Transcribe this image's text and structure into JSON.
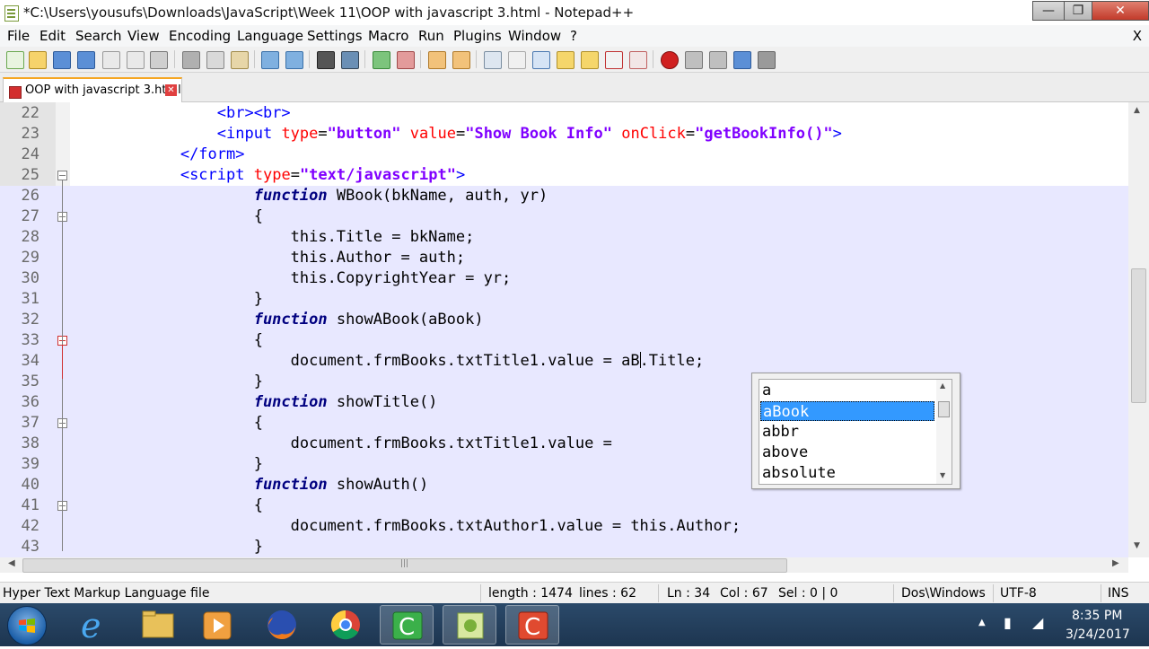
{
  "window": {
    "title": "*C:\\Users\\yousufs\\Downloads\\JavaScript\\Week 11\\OOP with javascript 3.html - Notepad++",
    "minimize": "—",
    "maximize": "❐",
    "close": "✕"
  },
  "menu": {
    "items": [
      "File",
      "Edit",
      "Search",
      "View",
      "Encoding",
      "Language",
      "Settings",
      "Macro",
      "Run",
      "Plugins",
      "Window",
      "?"
    ],
    "close_doc": "X"
  },
  "tabs": [
    {
      "label": "OOP with javascript 3.html",
      "close": "✕"
    }
  ],
  "editor": {
    "lines": [
      {
        "n": "22",
        "indent": "                ",
        "html": "<span class=\"tag\">&lt;br&gt;&lt;br&gt;</span>"
      },
      {
        "n": "23",
        "indent": "                ",
        "html": "<span class=\"tag\">&lt;input</span> <span class=\"attr\">type</span>=<span class=\"str\">\"button\"</span> <span class=\"attr\">value</span>=<span class=\"str\">\"Show Book Info\"</span> <span class=\"attr\">onClick</span>=<span class=\"str\">\"getBookInfo()\"</span><span class=\"tag\">&gt;</span>"
      },
      {
        "n": "24",
        "indent": "            ",
        "html": "<span class=\"tag\">&lt;/form&gt;</span>"
      },
      {
        "n": "25",
        "indent": "            ",
        "html": "<span class=\"tag\">&lt;script</span> <span class=\"attr\">type</span>=<span class=\"str\">\"text/javascript\"</span><span class=\"tag\">&gt;</span>"
      },
      {
        "n": "26",
        "indent": "                    ",
        "html": "<span class=\"kw\">function</span> WBook(bkName, auth, yr)"
      },
      {
        "n": "27",
        "indent": "                    ",
        "html": "{"
      },
      {
        "n": "28",
        "indent": "                        ",
        "html": "this.Title = bkName;"
      },
      {
        "n": "29",
        "indent": "                        ",
        "html": "this.Author = auth;"
      },
      {
        "n": "30",
        "indent": "                        ",
        "html": "this.CopyrightYear = yr;"
      },
      {
        "n": "31",
        "indent": "                    ",
        "html": "}"
      },
      {
        "n": "32",
        "indent": "                    ",
        "html": "<span class=\"kw\">function</span> showABook(aBook)"
      },
      {
        "n": "33",
        "indent": "                    ",
        "html": "{"
      },
      {
        "n": "34",
        "indent": "                        ",
        "html": "document.frmBooks.txtTitle1.value = aB<span class=\"caret\"></span>.Title;"
      },
      {
        "n": "35",
        "indent": "                    ",
        "html": "}"
      },
      {
        "n": "36",
        "indent": "                    ",
        "html": "<span class=\"kw\">function</span> showTitle()"
      },
      {
        "n": "37",
        "indent": "                    ",
        "html": "{"
      },
      {
        "n": "38",
        "indent": "                        ",
        "html": "document.frmBooks.txtTitle1.value = "
      },
      {
        "n": "39",
        "indent": "                    ",
        "html": "}"
      },
      {
        "n": "40",
        "indent": "                    ",
        "html": "<span class=\"kw\">function</span> showAuth()"
      },
      {
        "n": "41",
        "indent": "                    ",
        "html": "{"
      },
      {
        "n": "42",
        "indent": "                        ",
        "html": "document.frmBooks.txtAuthor1.value = this.Author;"
      },
      {
        "n": "43",
        "indent": "                    ",
        "html": "}"
      }
    ]
  },
  "autocomplete": {
    "items": [
      "a",
      "aBook",
      "abbr",
      "above",
      "absolute"
    ],
    "selected": "aBook"
  },
  "status": {
    "file_type": "Hyper Text Markup Language file",
    "length": "length : 1474",
    "lines": "lines : 62",
    "ln": "Ln : 34",
    "col": "Col : 67",
    "sel": "Sel : 0 | 0",
    "eol": "Dos\\Windows",
    "encoding": "UTF-8",
    "mode": "INS"
  },
  "taskbar": {
    "time": "8:35 PM",
    "date": "3/24/2017",
    "apps": [
      "start-button",
      "internet-explorer",
      "file-explorer",
      "media-player",
      "firefox",
      "chrome",
      "camtasia-recorder",
      "notepad-plus-plus",
      "camtasia-studio"
    ]
  },
  "colors": {
    "tag": "#0000ff",
    "attribute": "#ff0000",
    "string": "#8000ff",
    "keyword": "#000080",
    "selection": "#3399ff",
    "tab_accent": "#f5a623"
  }
}
